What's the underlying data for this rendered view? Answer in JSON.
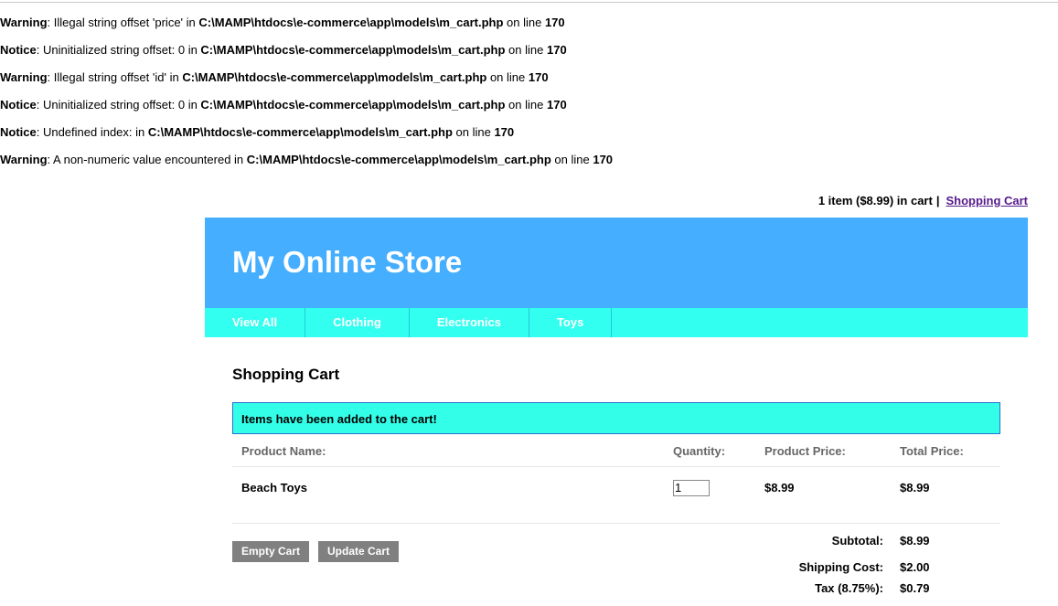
{
  "php_errors": [
    {
      "type": "Warning",
      "message": ": Illegal string offset 'price' in ",
      "path": "C:\\MAMP\\htdocs\\e-commerce\\app\\models\\m_cart.php",
      "on_line": " on line ",
      "line": "170"
    },
    {
      "type": "Notice",
      "message": ": Uninitialized string offset: 0 in ",
      "path": "C:\\MAMP\\htdocs\\e-commerce\\app\\models\\m_cart.php",
      "on_line": " on line ",
      "line": "170"
    },
    {
      "type": "Warning",
      "message": ": Illegal string offset 'id' in ",
      "path": "C:\\MAMP\\htdocs\\e-commerce\\app\\models\\m_cart.php",
      "on_line": " on line ",
      "line": "170"
    },
    {
      "type": "Notice",
      "message": ": Uninitialized string offset: 0 in ",
      "path": "C:\\MAMP\\htdocs\\e-commerce\\app\\models\\m_cart.php",
      "on_line": " on line ",
      "line": "170"
    },
    {
      "type": "Notice",
      "message": ": Undefined index: in ",
      "path": "C:\\MAMP\\htdocs\\e-commerce\\app\\models\\m_cart.php",
      "on_line": " on line ",
      "line": "170"
    },
    {
      "type": "Warning",
      "message": ": A non-numeric value encountered in ",
      "path": "C:\\MAMP\\htdocs\\e-commerce\\app\\models\\m_cart.php",
      "on_line": " on line ",
      "line": "170"
    }
  ],
  "cart_status": {
    "summary": "1 item ($8.99) in cart",
    "separator": "|",
    "link_label": "Shopping Cart"
  },
  "header": {
    "store_name": "My Online Store"
  },
  "nav": {
    "items": [
      {
        "label": "View All"
      },
      {
        "label": "Clothing"
      },
      {
        "label": "Electronics"
      },
      {
        "label": "Toys"
      }
    ]
  },
  "page": {
    "title": "Shopping Cart",
    "message": "Items have been added to the cart!"
  },
  "table": {
    "headers": {
      "name": "Product Name:",
      "quantity": "Quantity:",
      "price": "Product Price:",
      "total": "Total Price:"
    },
    "rows": [
      {
        "name": "Beach Toys",
        "quantity": "1",
        "price": "$8.99",
        "total": "$8.99"
      }
    ]
  },
  "buttons": {
    "empty_cart": "Empty Cart",
    "update_cart": "Update Cart"
  },
  "totals": {
    "subtotal_label": "Subtotal:",
    "subtotal_value": "$8.99",
    "shipping_label": "Shipping Cost:",
    "shipping_value": "$2.00",
    "tax_label": "Tax (8.75%):",
    "tax_value": "$0.79"
  },
  "colors": {
    "header_bg": "#45aefe",
    "nav_bg": "#33fff0",
    "message_bg": "#33ffe8",
    "button_bg": "#808080",
    "link": "#551a8b"
  }
}
